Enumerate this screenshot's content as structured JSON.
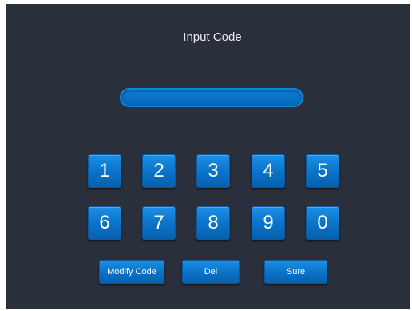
{
  "title": "Input Code",
  "code_field": {
    "value": ""
  },
  "keypad": {
    "row1": [
      "1",
      "2",
      "3",
      "4",
      "5"
    ],
    "row2": [
      "6",
      "7",
      "8",
      "9",
      "0"
    ]
  },
  "actions": {
    "modify_label": "Modify Code",
    "del_label": "Del",
    "sure_label": "Sure"
  },
  "colors": {
    "background": "#2a2f3c",
    "accent": "#0a72c7"
  }
}
